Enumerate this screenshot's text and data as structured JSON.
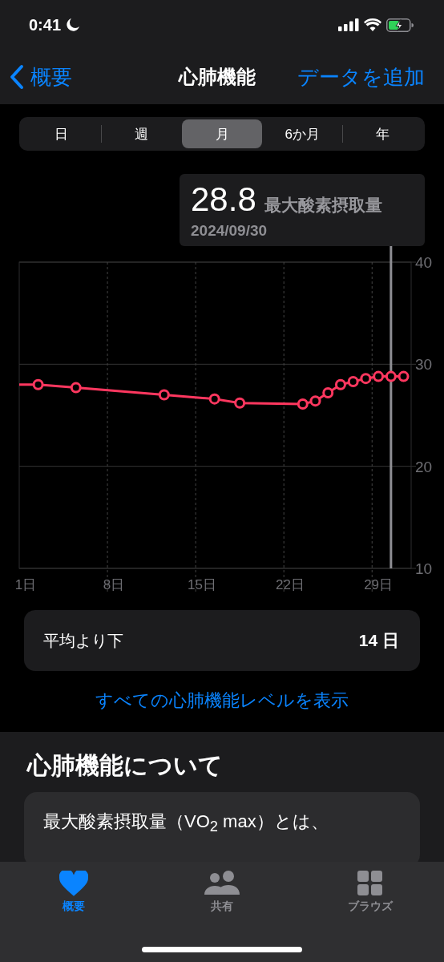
{
  "status_bar": {
    "time": "0:41"
  },
  "nav": {
    "back": "概要",
    "title": "心肺機能",
    "action": "データを追加"
  },
  "segments": [
    {
      "label": "日",
      "selected": false
    },
    {
      "label": "週",
      "selected": false
    },
    {
      "label": "月",
      "selected": true
    },
    {
      "label": "6か月",
      "selected": false
    },
    {
      "label": "年",
      "selected": false
    }
  ],
  "tooltip": {
    "value": "28.8",
    "unit": "最大酸素摂取量",
    "date": "2024/09/30"
  },
  "chart_data": {
    "type": "line",
    "x": [
      0.5,
      2,
      5,
      12,
      16,
      18,
      23,
      24,
      25,
      26,
      27,
      28,
      29,
      30,
      31
    ],
    "series": [
      {
        "color": "#ff375f",
        "marker": "circle",
        "values": [
          28.0,
          28.0,
          27.7,
          27.0,
          26.6,
          26.2,
          26.1,
          26.4,
          27.2,
          28.0,
          28.3,
          28.6,
          28.8,
          28.8,
          28.8
        ]
      }
    ],
    "xlim": [
      0.5,
      31.6
    ],
    "ylim": [
      10,
      40
    ],
    "xticks": [
      {
        "value": 1,
        "label": "1日"
      },
      {
        "value": 8,
        "label": "8日"
      },
      {
        "value": 15,
        "label": "15日"
      },
      {
        "value": 22,
        "label": "22日"
      },
      {
        "value": 29,
        "label": "29日"
      }
    ],
    "yticks": [
      10,
      20,
      30,
      40
    ],
    "ref_lines": [
      {
        "axis": "x",
        "value": 30,
        "color": "#8e8e93"
      }
    ]
  },
  "summary": {
    "label": "平均より下",
    "value": "14 日"
  },
  "link": "すべての心肺機能レベルを表示",
  "about": {
    "title": "心肺機能について",
    "text": "最大酸素摂取量（VO$_{2}$ max）とは、"
  },
  "tab_bar": [
    {
      "label": "概要",
      "selected": true
    },
    {
      "label": "共有",
      "selected": false
    },
    {
      "label": "ブラウズ",
      "selected": false
    }
  ]
}
